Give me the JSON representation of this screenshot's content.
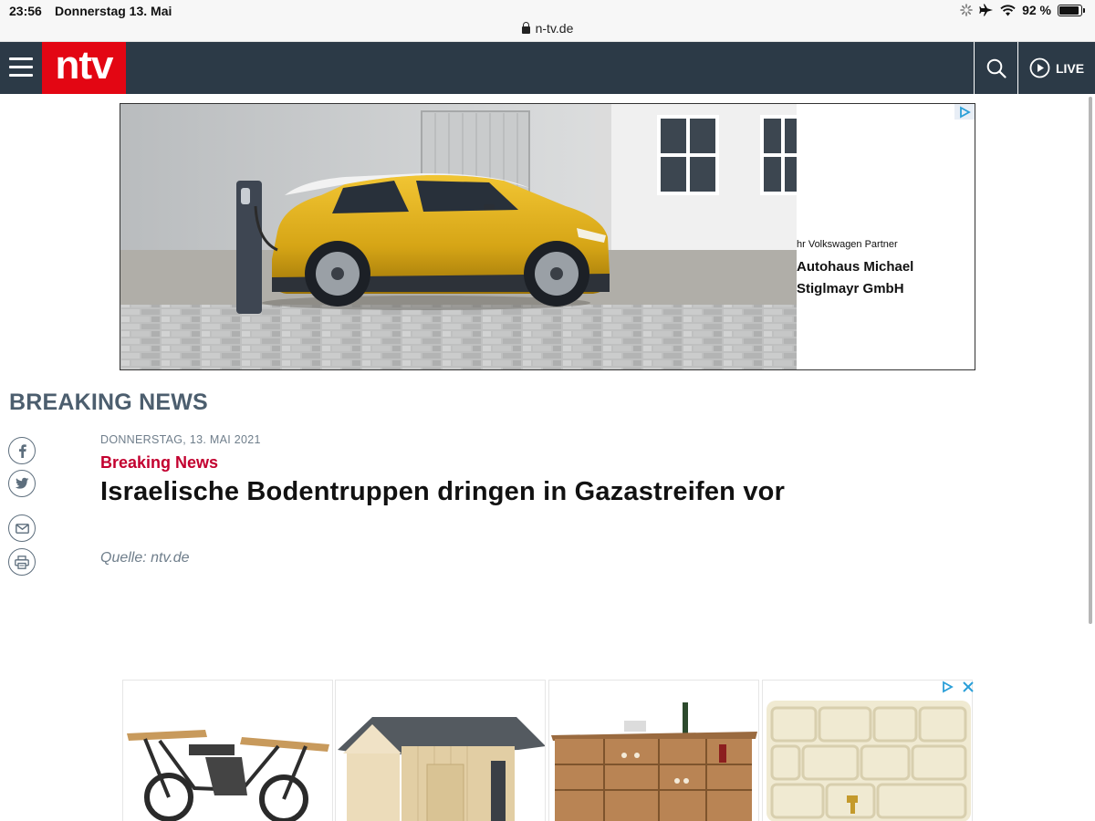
{
  "status_bar": {
    "time": "23:56",
    "date": "Donnerstag 13. Mai",
    "battery": "92 %",
    "battery_level": 0.92
  },
  "browser": {
    "url": "n-tv.de"
  },
  "header": {
    "logo_text": "ntv",
    "live_label": "LIVE",
    "brand_color": "#e30613",
    "bar_color": "#2c3a47"
  },
  "ad_banner": {
    "partner_text": "hr Volkswagen Partner",
    "dealer_line1": "Autohaus Michael",
    "dealer_line2": "Stiglmayr GmbH"
  },
  "article": {
    "section_title": "BREAKING NEWS",
    "date": "DONNERSTAG, 13. MAI 2021",
    "kicker": "Breaking News",
    "headline": "Israelische Bodentruppen dringen in Gazastreifen vor",
    "source": "Quelle: ntv.de",
    "kicker_color": "#c3002f"
  },
  "share_icons": [
    "facebook-icon",
    "twitter-icon",
    "mail-icon",
    "print-icon"
  ],
  "product_ads": [
    "motorcycle-bar-table",
    "garden-shed",
    "wooden-bar-cabinet",
    "stone-water-tank"
  ]
}
